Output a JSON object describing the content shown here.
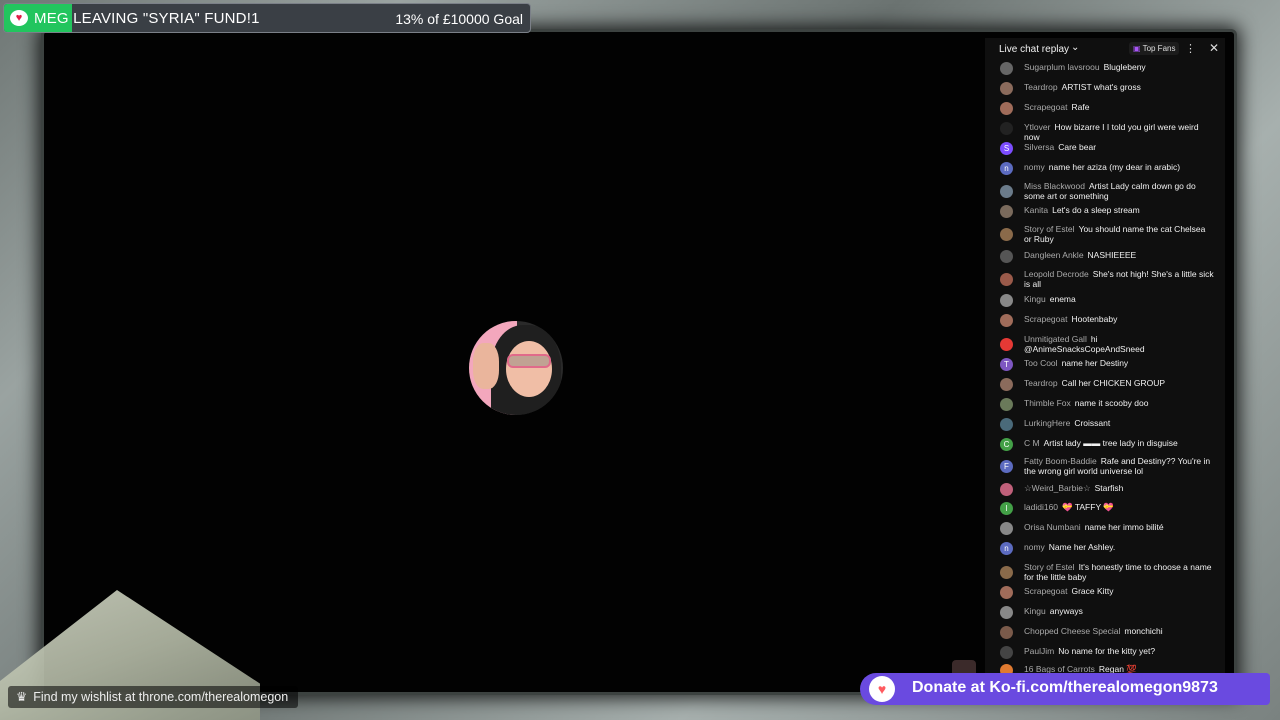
{
  "goal": {
    "icon": "heart-cup-icon",
    "title": "MEG LEAVING \"SYRIA\" FUND!1",
    "progress_text": "13% of £10000 Goal",
    "progress_fraction": 0.13
  },
  "chat": {
    "title": "Live chat replay",
    "top_fans_label": "Top Fans",
    "messages": [
      {
        "author": "Sugarplum lavsroou",
        "text": "Bluglebeny",
        "avatar": "",
        "color": "#666"
      },
      {
        "author": "Teardrop",
        "text": "ARTIST what's gross",
        "avatar": "",
        "color": "#8b6b5c"
      },
      {
        "author": "Scrapegoat",
        "text": "Rafe",
        "avatar": "",
        "color": "#a06c5a"
      },
      {
        "author": "Ytlover",
        "text": "How bizarre I I told you girl were weird now",
        "avatar": "",
        "color": "#222"
      },
      {
        "author": "Silversa",
        "text": "Care bear",
        "avatar": "S",
        "color": "#7c4dff"
      },
      {
        "author": "nomy",
        "text": "name her aziza (my dear in arabic)",
        "avatar": "n",
        "color": "#5c6bc0"
      },
      {
        "author": "Miss Blackwood",
        "text": "Artist Lady calm down go do some art or something",
        "avatar": "",
        "color": "#6b7b8a"
      },
      {
        "author": "Kanita",
        "text": "Let's do a sleep stream",
        "avatar": "",
        "color": "#7a6a5c"
      },
      {
        "author": "Story of Estel",
        "text": "You should name the cat Chelsea or Ruby",
        "avatar": "",
        "color": "#8a6a4a"
      },
      {
        "author": "Dangleen Ankle",
        "text": "NASHIEEEE",
        "avatar": "",
        "color": "#555"
      },
      {
        "author": "Leopold Decrode",
        "text": "She's not high! She's a little sick is all",
        "avatar": "",
        "color": "#9a5a4a"
      },
      {
        "author": "Kingu",
        "text": "enema",
        "avatar": "",
        "color": "#888"
      },
      {
        "author": "Scrapegoat",
        "text": "Hootenbaby",
        "avatar": "",
        "color": "#a06c5a"
      },
      {
        "author": "Unmitigated Gall",
        "text": "hi @AnimeSnacksCopeAndSneed",
        "avatar": "",
        "color": "#e53935"
      },
      {
        "author": "Too Cool",
        "text": "name her Destiny",
        "avatar": "T",
        "color": "#7e57c2"
      },
      {
        "author": "Teardrop",
        "text": "Call her CHICKEN GROUP",
        "avatar": "",
        "color": "#8b6b5c"
      },
      {
        "author": "Thimble Fox",
        "text": "name it scooby doo",
        "avatar": "",
        "color": "#6a7a5a"
      },
      {
        "author": "LurkingHere",
        "text": "Croissant",
        "avatar": "",
        "color": "#4a6a7a"
      },
      {
        "author": "C M",
        "text": "Artist lady ▬▬ tree lady in disguise",
        "avatar": "C",
        "color": "#43a047"
      },
      {
        "author": "Fatty Boom-Baddie",
        "text": "Rafe and Destiny?? You're in the wrong girl world universe lol",
        "avatar": "F",
        "color": "#5c6bc0"
      },
      {
        "author": "☆Weird_Barbie☆",
        "text": "Starfish",
        "avatar": "",
        "color": "#c0607a"
      },
      {
        "author": "ladidi160",
        "text": "💝 TAFFY 💝",
        "avatar": "l",
        "color": "#43a047"
      },
      {
        "author": "Orisa Numbani",
        "text": "name her immo bilité",
        "avatar": "",
        "color": "#888"
      },
      {
        "author": "nomy",
        "text": "Name her Ashley.",
        "avatar": "n",
        "color": "#5c6bc0"
      },
      {
        "author": "Story of Estel",
        "text": "It's honestly time to choose a name for the little baby",
        "avatar": "",
        "color": "#8a6a4a"
      },
      {
        "author": "Scrapegoat",
        "text": "Grace Kitty",
        "avatar": "",
        "color": "#a06c5a"
      },
      {
        "author": "Kingu",
        "text": "anyways",
        "avatar": "",
        "color": "#888"
      },
      {
        "author": "Chopped Cheese Special",
        "text": "monchichi",
        "avatar": "",
        "color": "#7a5a4a"
      },
      {
        "author": "PaulJim",
        "text": "No name for the kitty yet?",
        "avatar": "",
        "color": "#444"
      },
      {
        "author": "16 Bags of Carrots",
        "text": "Regan 💯",
        "avatar": "",
        "color": "#e07a30"
      }
    ]
  },
  "wishlist_text": "Find my wishlist at throne.com/therealomegon",
  "donate_text": "Donate at Ko-fi.com/therealomegon9873"
}
